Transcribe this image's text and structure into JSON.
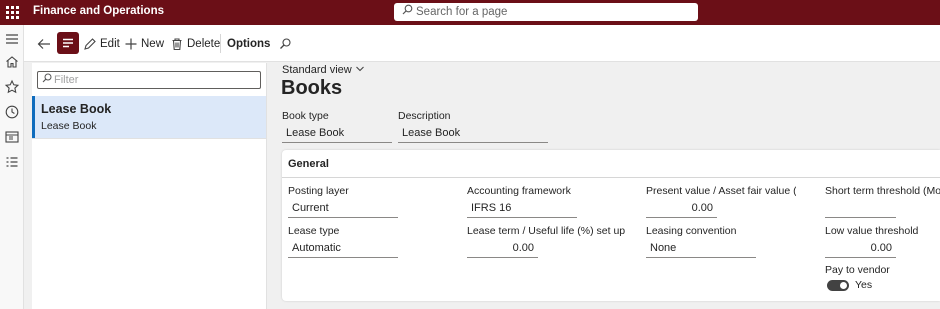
{
  "app": {
    "title": "Finance and Operations",
    "search_placeholder": "Search for a page"
  },
  "toolbar": {
    "edit_label": "Edit",
    "new_label": "New",
    "delete_label": "Delete",
    "options_label": "Options"
  },
  "list": {
    "filter_placeholder": "Filter",
    "items": [
      {
        "title": "Lease Book",
        "subtitle": "Lease Book"
      }
    ]
  },
  "details": {
    "view_label": "Standard view",
    "title": "Books",
    "header_fields": [
      {
        "label": "Book type",
        "value": "Lease Book"
      },
      {
        "label": "Description",
        "value": "Lease Book"
      }
    ],
    "general": {
      "header": "General",
      "fields": {
        "posting_layer": {
          "label": "Posting layer",
          "value": "Current"
        },
        "lease_type": {
          "label": "Lease type",
          "value": "Automatic"
        },
        "accounting_framework": {
          "label": "Accounting framework",
          "value": "IFRS 16"
        },
        "lease_term": {
          "label": "Lease term / Useful life (%) set up",
          "value": "0.00"
        },
        "present_value": {
          "label": "Present value / Asset fair value (...",
          "value": "0.00"
        },
        "leasing_convention": {
          "label": "Leasing convention",
          "value": "None"
        },
        "short_term": {
          "label": "Short term threshold (Months)",
          "value": ""
        },
        "low_value": {
          "label": "Low value threshold",
          "value": "0.00"
        },
        "pay_to_vendor": {
          "label": "Pay to vendor",
          "value": "Yes",
          "on": true
        }
      }
    }
  },
  "colors": {
    "brand": "#6b0f17",
    "selection": "#dce8f9",
    "accent": "#0f6cbd"
  }
}
